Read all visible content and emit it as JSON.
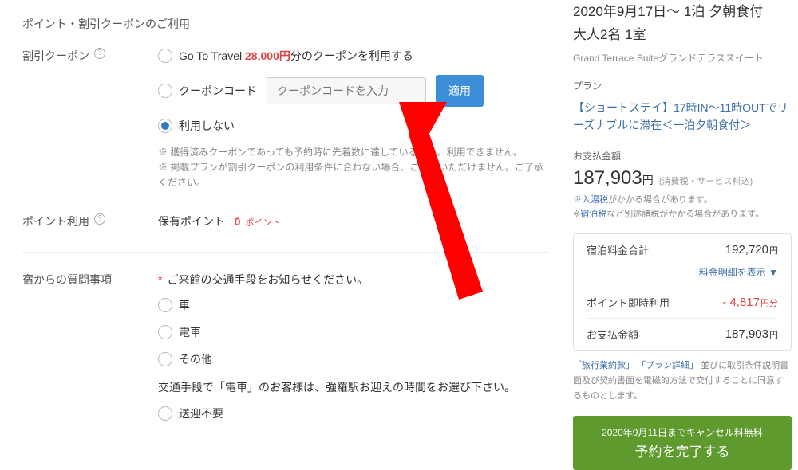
{
  "section_points_title": "ポイント・割引クーポンのご利用",
  "coupon": {
    "label": "割引クーポン",
    "goto_prefix": "Go To Travel",
    "goto_amount": "28,000円",
    "goto_suffix": "分のクーポンを利用する",
    "code_label": "クーポンコード",
    "code_placeholder": "クーポンコードを入力",
    "apply_btn": "適用",
    "none_label": "利用しない",
    "note1": "※ 獲得済みクーポンであっても予約時に先着数に達している場合、利用できません。",
    "note2": "※ 掲載プランが割引クーポンの利用条件に合わない場合、ご利用いただけません。ご了承ください。"
  },
  "points": {
    "label": "ポイント利用",
    "held_label": "保有ポイント",
    "held_value": "0",
    "held_unit": "ポイント"
  },
  "question": {
    "label": "宿からの質問事項",
    "q_transport": "ご来館の交通手段をお知らせください。",
    "opt_car": "車",
    "opt_train": "電車",
    "opt_other": "その他",
    "q_pickup": "交通手段で「電車」のお客様は、強羅駅お迎えの時間をお選び下さい。",
    "opt_none": "送迎不要"
  },
  "sidebar": {
    "date_line": "2020年9月17日〜 1泊 夕朝食付",
    "guest_line": "大人2名 1室",
    "suite_line": "Grand Terrace Suiteグランドテラススイート",
    "plan_hdr": "プラン",
    "plan_link": "【ショートステイ】17時IN〜11時OUTでリーズナブルに滞在＜一泊夕朝食付＞",
    "price_hdr": "お支払金額",
    "price_value": "187,903",
    "price_yen": "円",
    "price_sub": "(消費税・サービス料込)",
    "tax_note_prefix": "※",
    "tax_link1": "入湯税",
    "tax_note_mid": "がかかる場合があります。",
    "tax_link2": "宿泊税",
    "tax_note_suffix": "など別途諸税がかかる場合があります。",
    "summary": {
      "total_label": "宿泊料金合計",
      "total_value": "192,720",
      "detail_link": "料金明細を表示 ▼",
      "points_label": "ポイント即時利用",
      "points_value": "- 4,817",
      "points_unit": "円分",
      "pay_label": "お支払金額",
      "pay_value": "187,903"
    },
    "terms": {
      "link1": "「旅行業約款」",
      "link2": "「プラン詳細」",
      "text": "並びに取引条件説明書面及び契約書面を電磁的方法で交付することに同意するものとします。"
    },
    "submit": {
      "cancel_line": "2020年9月11日までキャンセル料無料",
      "main_line": "予約を完了する"
    }
  }
}
